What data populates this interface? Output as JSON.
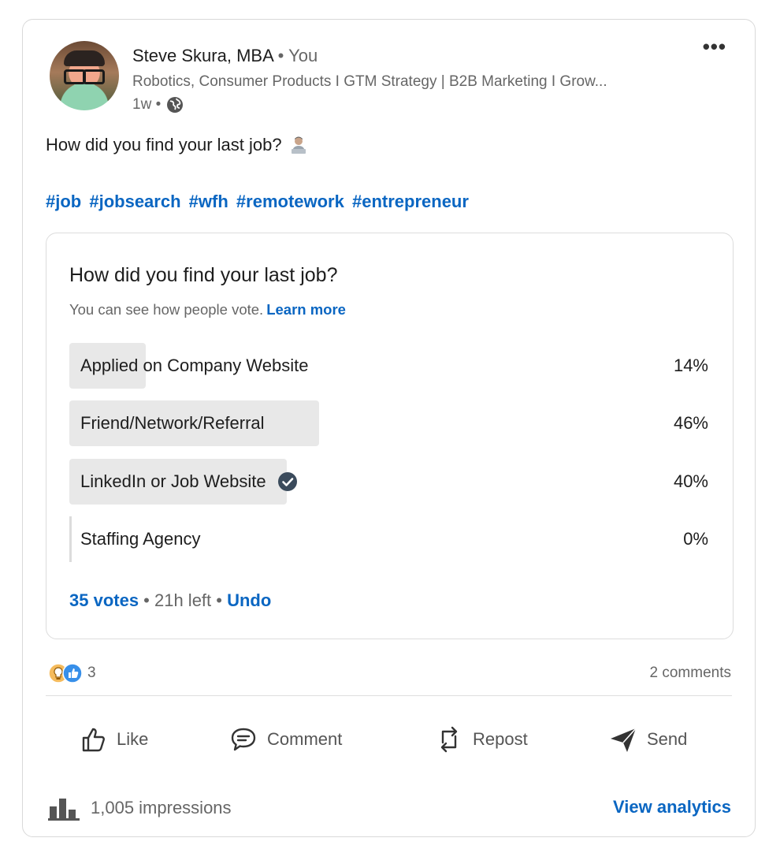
{
  "author": {
    "name": "Steve Skura, MBA",
    "separator": " • ",
    "relation": "You",
    "headline": "Robotics, Consumer Products I GTM Strategy | B2B Marketing I Grow...",
    "time": "1w •"
  },
  "post": {
    "text": "How did you find your last job?",
    "hashtags": [
      "#job",
      "#jobsearch",
      "#wfh",
      "#remotework",
      "#entrepreneur"
    ]
  },
  "poll": {
    "question": "How did you find your last job?",
    "info": "You can see how people vote.",
    "learn_more": "Learn more",
    "options": [
      {
        "label": "Applied on Company Website",
        "percent": "14%",
        "fill": 0.14
      },
      {
        "label": "Friend/Network/Referral",
        "percent": "46%",
        "fill": 0.46
      },
      {
        "label": "LinkedIn or Job Website",
        "percent": "40%",
        "fill": 0.4,
        "selected": true
      },
      {
        "label": "Staffing Agency",
        "percent": "0%",
        "fill": 0.0
      }
    ],
    "votes": "35 votes",
    "time_left": " • 21h left • ",
    "undo": "Undo"
  },
  "social": {
    "reaction_count": "3",
    "comments": "2 comments"
  },
  "actions": {
    "like": "Like",
    "comment": "Comment",
    "repost": "Repost",
    "send": "Send"
  },
  "footer": {
    "impressions": "1,005 impressions",
    "view_analytics": "View analytics"
  },
  "colors": {
    "accent": "#0a66c2",
    "bar": "#e8e8e8",
    "muted": "#666666"
  },
  "icons": [
    "more-icon",
    "globe-icon",
    "emoji-icon",
    "check-icon",
    "insightful-icon",
    "like-reaction-icon",
    "like-icon",
    "comment-icon",
    "repost-icon",
    "send-icon",
    "bar-chart-icon"
  ]
}
